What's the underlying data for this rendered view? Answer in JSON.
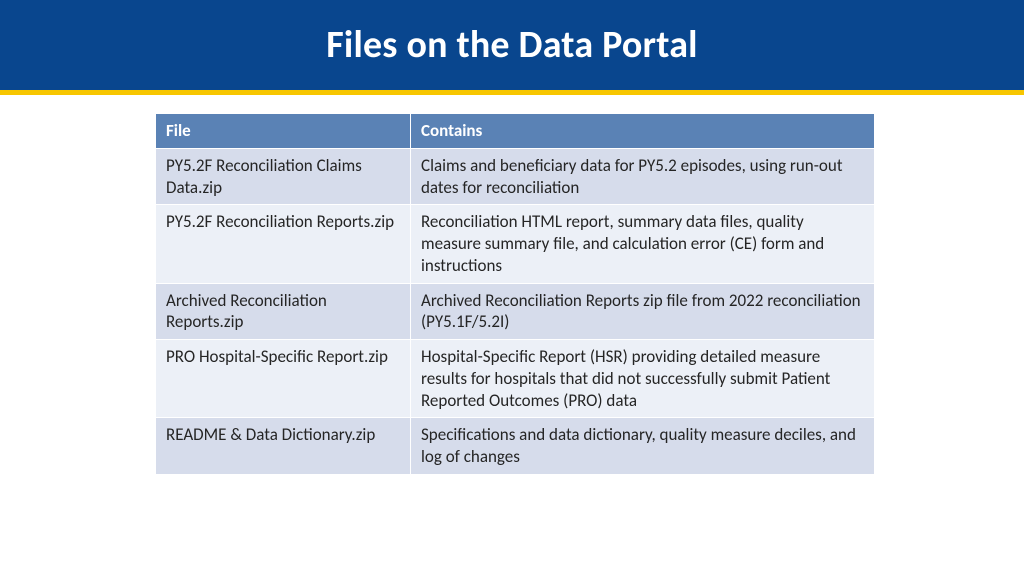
{
  "header": {
    "title": "Files on the Data Portal"
  },
  "table": {
    "headers": {
      "file": "File",
      "contains": "Contains"
    },
    "rows": [
      {
        "file": "PY5.2F Reconciliation Claims Data.zip",
        "contains": "Claims and beneficiary data for PY5.2 episodes, using run-out dates for reconciliation"
      },
      {
        "file": "PY5.2F Reconciliation Reports.zip",
        "contains": "Reconciliation HTML report, summary data files, quality measure summary file, and calculation error (CE) form and instructions"
      },
      {
        "file": "Archived Reconciliation Reports.zip",
        "contains": "Archived Reconciliation Reports zip file from 2022 reconciliation (PY5.1F/5.2I)"
      },
      {
        "file": "PRO Hospital-Specific Report.zip",
        "contains": "Hospital-Specific Report (HSR) providing detailed measure results for hospitals that did not successfully submit Patient Reported Outcomes (PRO) data"
      },
      {
        "file": "README & Data Dictionary.zip",
        "contains": "Specifications and data dictionary, quality measure deciles, and log of changes"
      }
    ]
  }
}
